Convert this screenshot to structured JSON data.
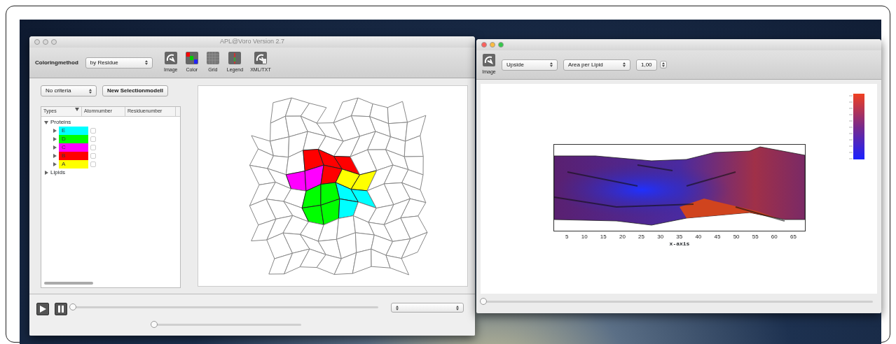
{
  "main_window": {
    "title": "APL@Voro Version 2.7",
    "active": false,
    "toolbar": {
      "label": "Coloringmethod",
      "select": "by Residue",
      "tools": [
        {
          "kind": "image",
          "label": "Image"
        },
        {
          "kind": "color",
          "label": "Color"
        },
        {
          "kind": "grid",
          "label": "Grid"
        },
        {
          "kind": "legend",
          "label": "Legend"
        },
        {
          "kind": "export",
          "label": "XML/TXT"
        }
      ]
    },
    "criteria_select": "No criteria",
    "new_button": "New Selectionmodell",
    "tree": {
      "columns": [
        "Types",
        "Atomnumber",
        "Residuenumber"
      ],
      "items": [
        {
          "label": "Proteins",
          "expanded": true,
          "children": [
            {
              "label": "E",
              "color": "#00ffff",
              "expanded": false,
              "checked": false
            },
            {
              "label": "D",
              "color": "#00ff00",
              "expanded": false,
              "checked": false
            },
            {
              "label": "C",
              "color": "#ff00ff",
              "expanded": false,
              "checked": false
            },
            {
              "label": "B",
              "color": "#ff0000",
              "expanded": false,
              "checked": false
            },
            {
              "label": "A",
              "color": "#ffff00",
              "expanded": false,
              "checked": false
            }
          ]
        },
        {
          "label": "Lipids",
          "expanded": false
        }
      ]
    },
    "player": {
      "position": {
        "level": 0
      },
      "speed": {
        "level": 0
      }
    }
  },
  "plot_window": {
    "active": true,
    "tools": [
      {
        "kind": "image",
        "label": "Image"
      }
    ],
    "selects": [
      "Upside",
      "Area per Lipid"
    ],
    "stepper_value": "1,00",
    "plot": {
      "xticks": [
        "5",
        "10",
        "15",
        "20",
        "25",
        "30",
        "35",
        "40",
        "45",
        "50",
        "55",
        "60",
        "65"
      ],
      "xlabel": "x-axis"
    },
    "slider": {
      "level": 0
    }
  }
}
